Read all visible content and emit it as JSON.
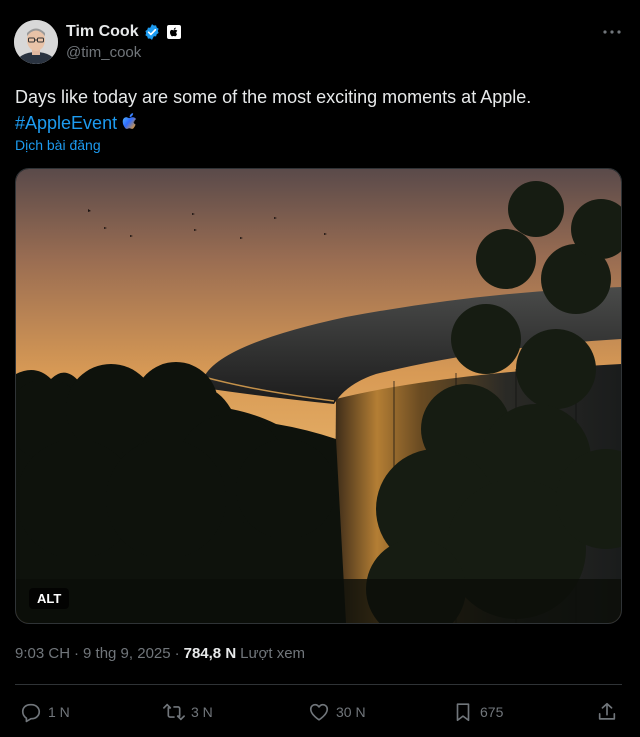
{
  "author": {
    "display_name": "Tim Cook",
    "handle": "@tim_cook",
    "avatar_icon": "avatar-photo",
    "verified_icon": "verified-badge-icon",
    "affiliation_icon": "apple-logo-icon"
  },
  "post": {
    "text": "Days like today are some of the most exciting moments at Apple.",
    "hashtag": "#AppleEvent",
    "translate_label": "Dịch bài đăng"
  },
  "media": {
    "alt_label": "ALT"
  },
  "meta": {
    "time": "9:03 CH",
    "separator": "·",
    "date": "9 thg 9, 2025",
    "views_count": "784,8 N",
    "views_label": "Lượt xem"
  },
  "actions": {
    "replies": "1 N",
    "reposts": "3 N",
    "likes": "30 N",
    "bookmarks": "675"
  },
  "colors": {
    "accent": "#1d9bf0",
    "muted": "#71767b",
    "text": "#e7e9ea",
    "background": "#000000"
  }
}
